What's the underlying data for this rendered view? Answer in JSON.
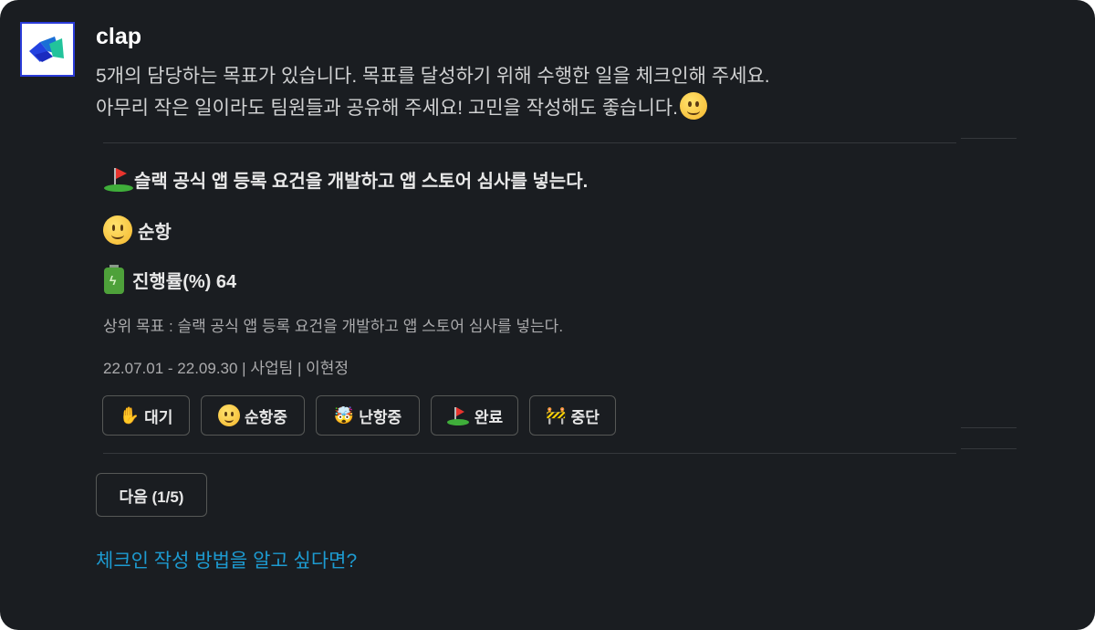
{
  "message": {
    "sender": "clap",
    "intro_line1": "5개의 담당하는 목표가 있습니다. 목표를 달성하기 위해 수행한 일을 체크인해 주세요.",
    "intro_line2": "아무리 작은 일이라도 팀원들과 공유해 주세요! 고민을 작성해도 좋습니다."
  },
  "goal": {
    "title": "슬랙 공식 앱 등록 요건을 개발하고 앱 스토어 심사를 넣는다.",
    "status": "순항",
    "progress_label": "진행률(%)",
    "progress_value": "64",
    "parent_goal": "상위 목표 : 슬랙 공식 앱 등록 요건을 개발하고 앱 스토어 심사를 넣는다.",
    "meta": "22.07.01 - 22.09.30 | 사업팀 | 이현정"
  },
  "status_buttons": [
    {
      "label": "대기",
      "icon": "raised-hand-icon"
    },
    {
      "label": "순항중",
      "icon": "smile-icon"
    },
    {
      "label": "난항중",
      "icon": "exploding-head-icon"
    },
    {
      "label": "완료",
      "icon": "golf-flag-icon"
    },
    {
      "label": "중단",
      "icon": "construction-barrier-icon"
    }
  ],
  "next_button": "다음 (1/5)",
  "help_link": "체크인 작성 방법을 알고 싶다면?",
  "colors": {
    "background": "#1a1d21",
    "text": "#d1d2d3",
    "link": "#1d9bd1",
    "button_border": "#565856"
  }
}
